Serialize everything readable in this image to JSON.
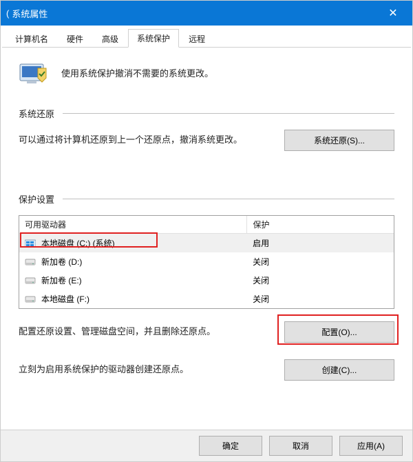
{
  "title_prefix": "(",
  "window_title": "系统属性",
  "tabs": {
    "computer_name": "计算机名",
    "hardware": "硬件",
    "advanced": "高级",
    "system_protection": "系统保护",
    "remote": "远程"
  },
  "header_text": "使用系统保护撤消不需要的系统更改。",
  "section_restore": {
    "title": "系统还原",
    "description": "可以通过将计算机还原到上一个还原点，撤消系统更改。",
    "button": "系统还原(S)..."
  },
  "section_protect": {
    "title": "保护设置",
    "col_drive": "可用驱动器",
    "col_protect": "保护",
    "drives": [
      {
        "icon": "win",
        "name": "本地磁盘 (C:) (系统)",
        "status": "启用",
        "selected": true
      },
      {
        "icon": "hdd",
        "name": "新加卷 (D:)",
        "status": "关闭",
        "selected": false
      },
      {
        "icon": "hdd",
        "name": "新加卷 (E:)",
        "status": "关闭",
        "selected": false
      },
      {
        "icon": "hdd",
        "name": "本地磁盘 (F:)",
        "status": "关闭",
        "selected": false
      }
    ],
    "configure_text": "配置还原设置、管理磁盘空间，并且删除还原点。",
    "configure_button": "配置(O)...",
    "create_text": "立刻为启用系统保护的驱动器创建还原点。",
    "create_button": "创建(C)..."
  },
  "footer": {
    "ok": "确定",
    "cancel": "取消",
    "apply": "应用(A)"
  }
}
